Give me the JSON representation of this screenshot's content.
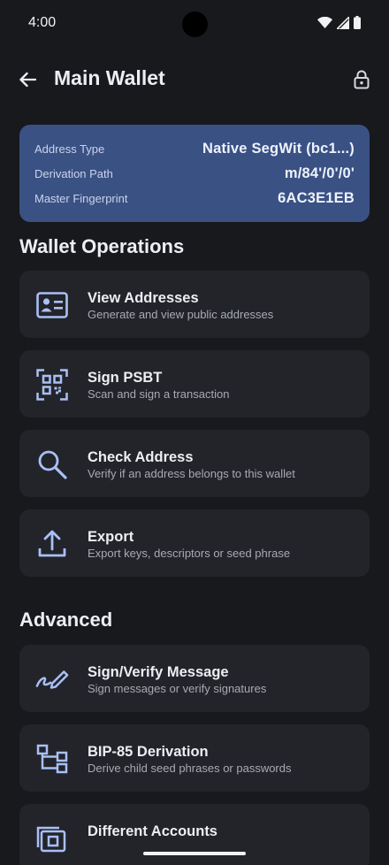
{
  "status": {
    "time": "4:00"
  },
  "appbar": {
    "title": "Main Wallet"
  },
  "info": {
    "address_type_label": "Address Type",
    "address_type_value": "Native SegWit (bc1...)",
    "derivation_label": "Derivation Path",
    "derivation_value": "m/84'/0'/0'",
    "fingerprint_label": "Master Fingerprint",
    "fingerprint_value": "6AC3E1EB"
  },
  "sections": {
    "operations": "Wallet Operations",
    "advanced": "Advanced"
  },
  "operations": [
    {
      "title": "View Addresses",
      "subtitle": "Generate and view public addresses",
      "icon": "id-card-icon"
    },
    {
      "title": "Sign PSBT",
      "subtitle": "Scan and sign a transaction",
      "icon": "qr-scan-icon"
    },
    {
      "title": "Check Address",
      "subtitle": "Verify if an address belongs to this wallet",
      "icon": "search-icon"
    },
    {
      "title": "Export",
      "subtitle": "Export keys, descriptors or seed phrase",
      "icon": "upload-icon"
    }
  ],
  "advanced": [
    {
      "title": "Sign/Verify Message",
      "subtitle": "Sign messages or verify signatures",
      "icon": "signature-icon"
    },
    {
      "title": "BIP-85 Derivation",
      "subtitle": "Derive child seed phrases or passwords",
      "icon": "tree-icon"
    },
    {
      "title": "Different Accounts",
      "subtitle": "",
      "icon": "accounts-icon"
    }
  ],
  "colors": {
    "background": "#18191d",
    "card": "#23242a",
    "info_card": "#3a5184",
    "accent_icon": "#a9c0f5"
  }
}
